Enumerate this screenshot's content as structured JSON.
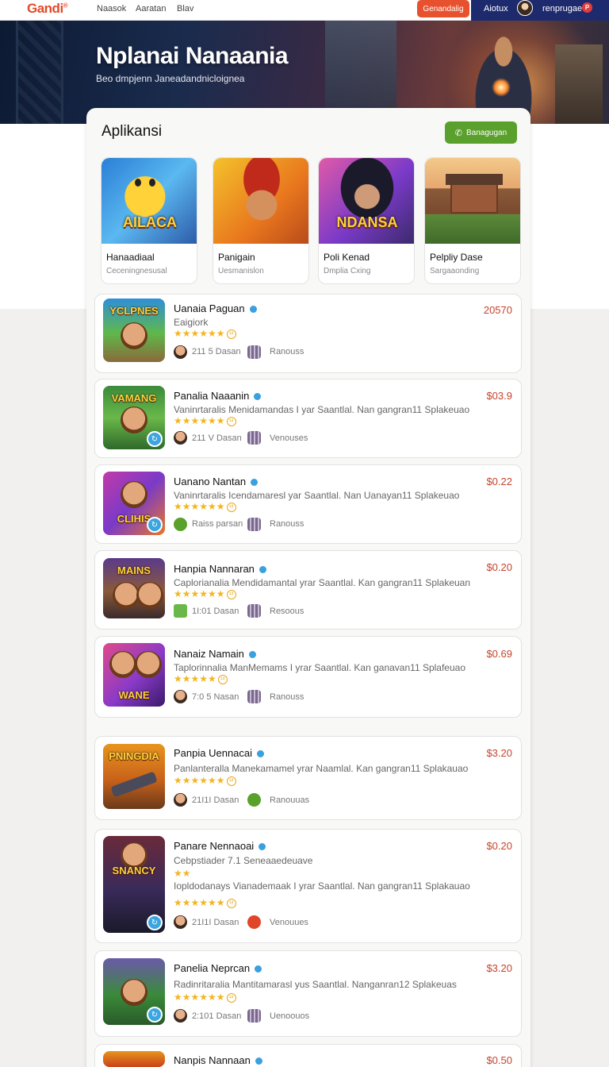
{
  "nav": {
    "logo": "Gandi",
    "logo_mark": "®",
    "links": [
      "Naasok",
      "Aaratan",
      "Blav"
    ],
    "cta_label": "Genandalig",
    "dark_link": "Aiotux",
    "username": "renprugae",
    "badge": "P"
  },
  "hero": {
    "title": "Nplanai Nanaania",
    "subtitle": "Beo dmpjenn Janeadandnicloignea"
  },
  "section": {
    "title": "Aplikansi",
    "button_label": "Banagugan",
    "button_icon": "phone-icon"
  },
  "featured": [
    {
      "name": "Hanaadiaal",
      "sub": "Ceceningnesusal",
      "art_text": "AILACA"
    },
    {
      "name": "Panigain",
      "sub": "Uesmanislon",
      "art_text": ""
    },
    {
      "name": "Poli Kenad",
      "sub": "Dmplia Cxing",
      "art_text": "NDANSA"
    },
    {
      "name": "Pelpliy Dase",
      "sub": "Sargaaonding",
      "art_text": ""
    }
  ],
  "items": [
    {
      "title": "Uanaia Paguan",
      "desc": "Eaigiork",
      "extra": "",
      "rating_text": "★★★★★★",
      "rating_badge": "¹³",
      "meta1": "211 5 Dasan",
      "meta2": "Ranouss",
      "price": "20570",
      "art_text": "YCLPNES"
    },
    {
      "title": "Panalia Naaanin",
      "desc": "Vaninrtaralis Menidamandas I yar Saantlal. Nan gangran11 Splakeuao",
      "extra": "",
      "rating_text": "★★★★★★",
      "rating_badge": "¹³",
      "meta1": "211 V Dasan",
      "meta2": "Venouses",
      "price": "$03.9",
      "art_text": "VAMANG"
    },
    {
      "title": "Uanano Nantan",
      "desc": "Vaninrtaralis Icendamaresl yar Saantlal. Nan Uanayan11 Splakeuao",
      "extra": "",
      "rating_text": "★★★★★★",
      "rating_badge": "¹³",
      "meta1": "Raiss parsan",
      "meta2": "Ranouss",
      "price": "$0.22",
      "art_text": "CLIHIS"
    },
    {
      "title": "Hanpia Nannaran",
      "desc": "Caplorianalia Mendidamantal yrar Saantlal. Kan gangran11 Splakeuan",
      "extra": "",
      "rating_text": "★★★★★★",
      "rating_badge": "¹³",
      "meta1": "1I:01 Dasan",
      "meta2": "Resoous",
      "price": "$0.20",
      "art_text": "MAINS"
    },
    {
      "title": "Nanaiz Namain",
      "desc": "Taplorinnalia ManMemams I yrar Saantlal. Kan ganavan11 Splafeuao",
      "extra": "",
      "rating_text": "★★★★★",
      "rating_badge": "¹³",
      "meta1": "7:0 5 Nasan",
      "meta2": "Ranouss",
      "price": "$0.69",
      "art_text": "WANE"
    },
    {
      "title": "Panpia Uennacai",
      "desc": "Panlanteralla Manekamamel yrar Naamlal. Kan gangran11 Splakauao",
      "extra": "",
      "rating_text": "★★★★★★",
      "rating_badge": "¹³",
      "meta1": "21I1I Dasan",
      "meta2": "Ranouuas",
      "price": "$3.20",
      "art_text": "PNINGDIA"
    },
    {
      "title": "Panare Nennaoai",
      "desc": "Iopldodanays Vianademaak I yrar Saantlal. Nan gangran11 Splakauao",
      "extra": "Cebpstiader 7.1 Seneaaedeuave",
      "rating_text": "★★★★★★",
      "rating_badge": "¹³",
      "meta1": "21I1I Dasan",
      "meta2": "Venouues",
      "price": "$0.20",
      "art_text": "SNANCY"
    },
    {
      "title": "Panelia Neprcan",
      "desc": "Radinritaralia Mantitamarasl yus Saantlal. Nanganran12 Splakeuas",
      "extra": "",
      "rating_text": "★★★★★★",
      "rating_badge": "¹³",
      "meta1": "2:101 Dasan",
      "meta2": "Uenoouos",
      "price": "$3.20",
      "art_text": ""
    },
    {
      "title": "Nanpis Nannaan",
      "desc": "",
      "extra": "",
      "rating_text": "",
      "rating_badge": "",
      "meta1": "",
      "meta2": "",
      "price": "$0.50",
      "art_text": ""
    }
  ],
  "colors": {
    "accent_green": "#5aa02c",
    "accent_red": "#e8512e",
    "price_red": "#c7432b",
    "nav_dark": "#1e2a6e",
    "star_gold": "#f3b521"
  }
}
